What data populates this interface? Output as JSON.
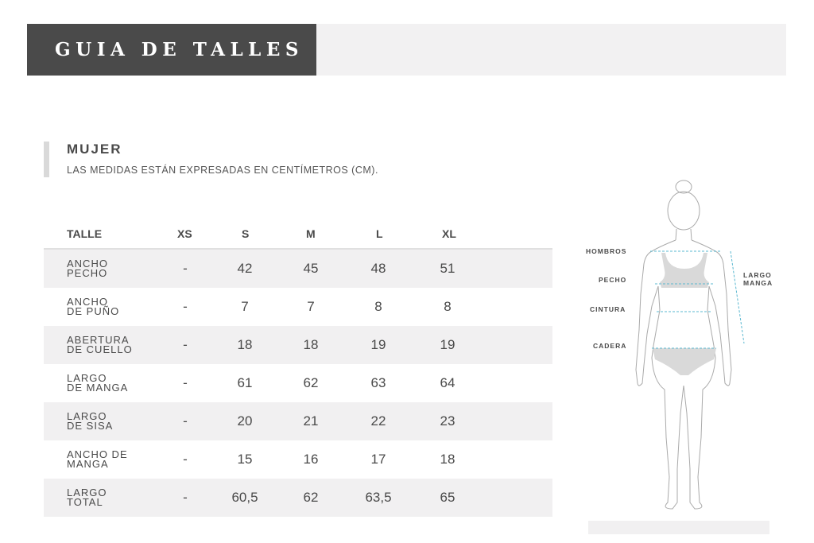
{
  "header": {
    "title": "GUIA DE TALLES"
  },
  "section": {
    "title": "MUJER",
    "subtitle": "LAS MEDIDAS ESTÁN EXPRESADAS EN CENTÍMETROS (CM)."
  },
  "table": {
    "columns": [
      "TALLE",
      "XS",
      "S",
      "M",
      "L",
      "XL"
    ],
    "rows": [
      {
        "label1": "ANCHO",
        "label2": "PECHO",
        "xs": "-",
        "s": "42",
        "m": "45",
        "l": "48",
        "xl": "51"
      },
      {
        "label1": "ANCHO",
        "label2": "DE PUÑO",
        "xs": "-",
        "s": "7",
        "m": "7",
        "l": "8",
        "xl": "8"
      },
      {
        "label1": "ABERTURA",
        "label2": "DE CUELLO",
        "xs": "-",
        "s": "18",
        "m": "18",
        "l": "19",
        "xl": "19"
      },
      {
        "label1": "LARGO",
        "label2": "DE MANGA",
        "xs": "-",
        "s": "61",
        "m": "62",
        "l": "63",
        "xl": "64"
      },
      {
        "label1": "LARGO",
        "label2": "DE SISA",
        "xs": "-",
        "s": "20",
        "m": "21",
        "l": "22",
        "xl": "23"
      },
      {
        "label1": "ANCHO DE",
        "label2": "MANGA",
        "xs": "-",
        "s": "15",
        "m": "16",
        "l": "17",
        "xl": "18"
      },
      {
        "label1": "LARGO",
        "label2": "TOTAL",
        "xs": "-",
        "s": "60,5",
        "m": "62",
        "l": "63,5",
        "xl": "65"
      }
    ]
  },
  "figure": {
    "labels": {
      "hombros": "HOMBROS",
      "pecho": "PECHO",
      "cintura": "CINTURA",
      "cadera": "CADERA",
      "largo_manga_1": "LARGO",
      "largo_manga_2": "MANGA"
    },
    "line_color": "#5bb8d0",
    "outline_color": "#aaaaaa",
    "garment_color": "#d9d9d9"
  }
}
